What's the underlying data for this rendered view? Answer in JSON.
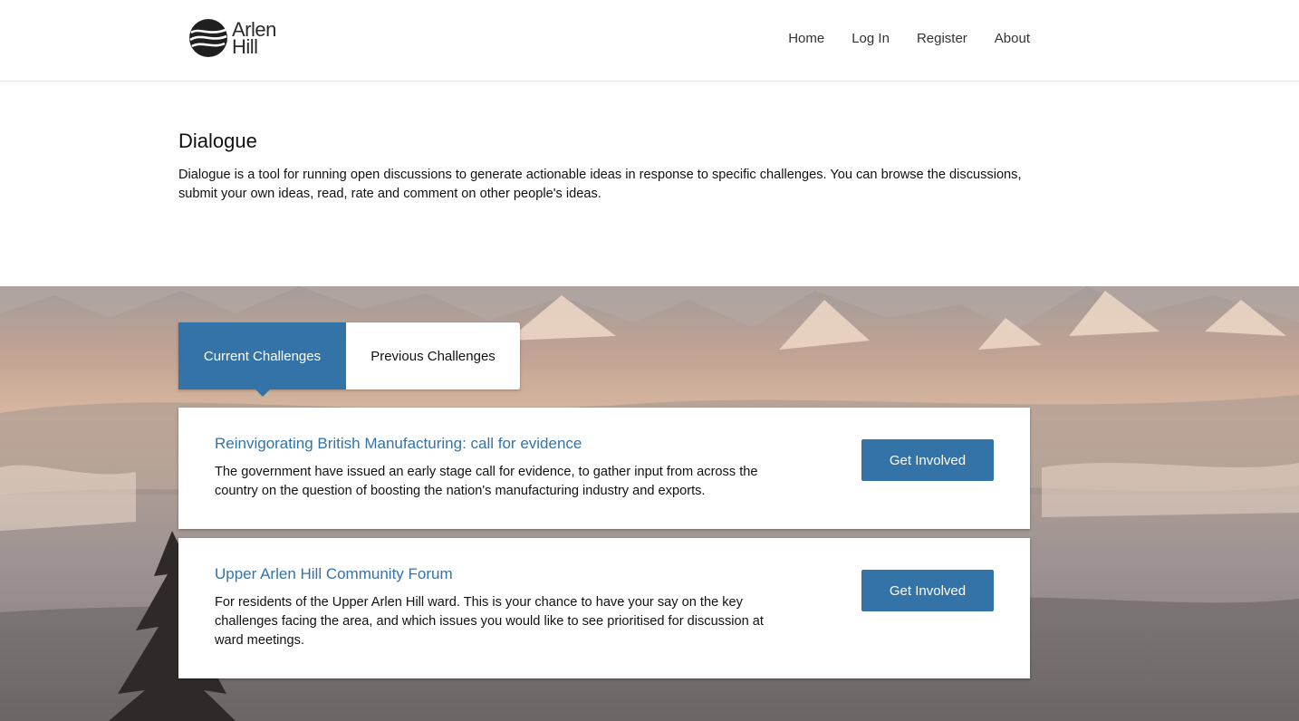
{
  "header": {
    "logo": {
      "line1": "Arlen",
      "line2": "Hill"
    },
    "nav": [
      {
        "label": "Home"
      },
      {
        "label": "Log In"
      },
      {
        "label": "Register"
      },
      {
        "label": "About"
      }
    ]
  },
  "intro": {
    "title": "Dialogue",
    "description": "Dialogue is a tool for running open discussions to generate actionable ideas in response to specific challenges. You can browse the discussions, submit your own ideas, read, rate and comment on other people's ideas."
  },
  "tabs": [
    {
      "label": "Current Challenges",
      "active": true
    },
    {
      "label": "Previous Challenges",
      "active": false
    }
  ],
  "challenges": [
    {
      "title": "Reinvigorating British Manufacturing: call for evidence",
      "description": "The government have issued an early stage call for evidence, to gather input from across the country on the question of boosting the nation's manufacturing industry and exports.",
      "button_label": "Get Involved"
    },
    {
      "title": "Upper Arlen Hill Community Forum",
      "description": "For residents of the Upper Arlen Hill ward. This is your chance to have your say on the key challenges facing the area, and which issues you would like to see prioritised for discussion at ward meetings.",
      "button_label": "Get Involved"
    }
  ],
  "colors": {
    "accent": "#3473a7",
    "text": "#111111"
  }
}
